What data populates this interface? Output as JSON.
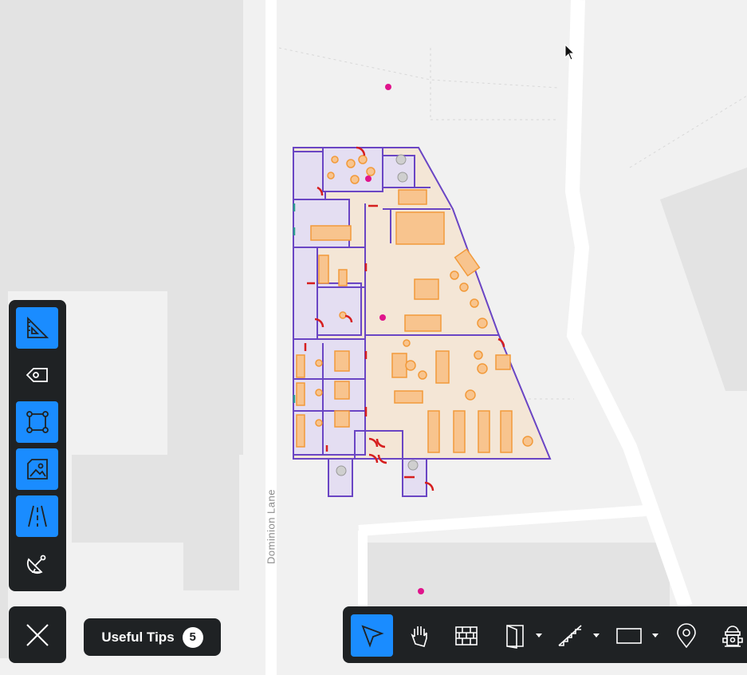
{
  "map": {
    "street_name": "Dominion Lane",
    "colors": {
      "background": "#f1f1f1",
      "block": "#e3e3e3",
      "road": "#ffffff",
      "floor_fill": "#f4e6d6",
      "room_fill": "#e4def2",
      "wall": "#6a45c4",
      "furniture": "#f29a3a",
      "door": "#d61f1f",
      "marker": "#e0148c"
    }
  },
  "layers_panel": {
    "items": [
      {
        "name": "measure-ruler-icon",
        "active": true
      },
      {
        "name": "tag-label-icon",
        "active": false
      },
      {
        "name": "shape-nodes-icon",
        "active": true
      },
      {
        "name": "image-layer-icon",
        "active": true
      },
      {
        "name": "road-lanes-icon",
        "active": true
      },
      {
        "name": "satellite-dish-icon",
        "active": false
      }
    ]
  },
  "tips": {
    "label": "Useful Tips",
    "count": "5"
  },
  "toolbar": {
    "tools": [
      {
        "name": "select-pointer-tool",
        "active": true,
        "dropdown": false
      },
      {
        "name": "pan-hand-tool",
        "active": false,
        "dropdown": false
      },
      {
        "name": "wall-brick-tool",
        "active": false,
        "dropdown": false
      },
      {
        "name": "door-tool",
        "active": false,
        "dropdown": true
      },
      {
        "name": "stairs-tool",
        "active": false,
        "dropdown": true
      },
      {
        "name": "rectangle-tool",
        "active": false,
        "dropdown": true
      },
      {
        "name": "location-pin-tool",
        "active": false,
        "dropdown": false
      },
      {
        "name": "fire-hydrant-tool",
        "active": false,
        "dropdown": false
      }
    ]
  },
  "accent_color": "#1a8cff",
  "panel_color": "#1f2224"
}
